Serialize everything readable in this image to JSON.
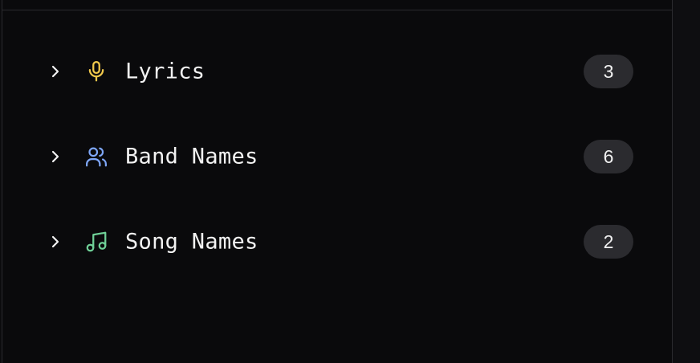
{
  "categories": [
    {
      "label": "Lyrics",
      "count": "3",
      "icon": "microphone-icon",
      "icon_color": "#f2c94c"
    },
    {
      "label": "Band Names",
      "count": "6",
      "icon": "users-icon",
      "icon_color": "#7ea6f7"
    },
    {
      "label": "Song Names",
      "count": "2",
      "icon": "music-note-icon",
      "icon_color": "#6fcf97"
    }
  ],
  "colors": {
    "background": "#0a0a0c",
    "text": "#f2f2f2",
    "badge_bg": "#2b2b2f",
    "border": "#2a2a2e"
  }
}
